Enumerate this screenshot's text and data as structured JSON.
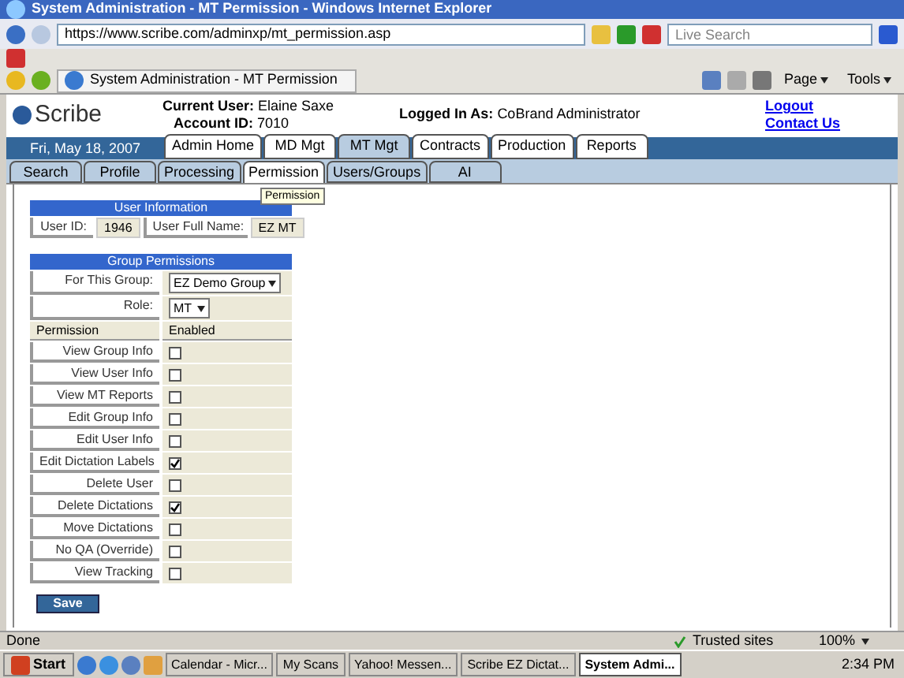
{
  "window": {
    "title": "System Administration - MT Permission - Windows Internet Explorer"
  },
  "address_bar": {
    "url": "https://www.scribe.com/adminxp/mt_permission.asp"
  },
  "search": {
    "placeholder": "Live Search"
  },
  "browser_tab": {
    "title": "System Administration - MT Permission"
  },
  "command_bar": [
    "Page",
    "Tools"
  ],
  "header": {
    "logo": "Scribe",
    "current_user_label": "Current User:",
    "current_user": "Elaine Saxe",
    "account_label": "Account ID:",
    "account": "7010",
    "logged_label": "Logged In As:",
    "logged_as": "CoBrand Administrator",
    "links": [
      "Logout",
      "Contact Us"
    ]
  },
  "date": "Fri, May 18, 2007",
  "main_tabs": [
    {
      "label": "Admin Home",
      "selected": false
    },
    {
      "label": "MD Mgt",
      "selected": false
    },
    {
      "label": "MT Mgt",
      "selected": true
    },
    {
      "label": "Contracts",
      "selected": false
    },
    {
      "label": "Production",
      "selected": false
    },
    {
      "label": "Reports",
      "selected": false
    }
  ],
  "sub_tabs": [
    {
      "label": "Search",
      "selected": false
    },
    {
      "label": "Profile",
      "selected": false
    },
    {
      "label": "Processing",
      "selected": false
    },
    {
      "label": "Permission",
      "selected": true
    },
    {
      "label": "Users/Groups",
      "selected": false
    },
    {
      "label": "AI",
      "selected": false
    }
  ],
  "tooltip": "Permission",
  "user_info": {
    "title": "User Information",
    "user_id_label": "User ID:",
    "user_id": "1946",
    "name_label": "User Full Name:",
    "name": "EZ MT"
  },
  "group_permissions": {
    "title": "Group Permissions",
    "group_label": "For This Group:",
    "group": "EZ Demo Group",
    "role_label": "Role:",
    "role": "MT",
    "columns": [
      "Permission",
      "Enabled"
    ],
    "rows": [
      {
        "name": "View Group Info",
        "checked": false
      },
      {
        "name": "View User Info",
        "checked": false
      },
      {
        "name": "View MT Reports",
        "checked": false
      },
      {
        "name": "Edit Group Info",
        "checked": false
      },
      {
        "name": "Edit User Info",
        "checked": false
      },
      {
        "name": "Edit Dictation Labels",
        "checked": true
      },
      {
        "name": "Delete User",
        "checked": false
      },
      {
        "name": "Delete Dictations",
        "checked": true
      },
      {
        "name": "Move Dictations",
        "checked": false
      },
      {
        "name": "No QA (Override)",
        "checked": false
      },
      {
        "name": "View Tracking",
        "checked": false
      }
    ]
  },
  "save_button": "Save",
  "status_bar": {
    "status": "Done",
    "zone": "Trusted sites",
    "zoom": "100%"
  },
  "taskbar": {
    "start": "Start",
    "tasks": [
      {
        "label": "Calendar - Micr...",
        "selected": false
      },
      {
        "label": "My Scans",
        "selected": false
      },
      {
        "label": "Yahoo! Messen...",
        "selected": false
      },
      {
        "label": "Scribe EZ Dictat...",
        "selected": false
      },
      {
        "label": "System Admi...",
        "selected": true
      }
    ],
    "clock": "2:34 PM"
  }
}
